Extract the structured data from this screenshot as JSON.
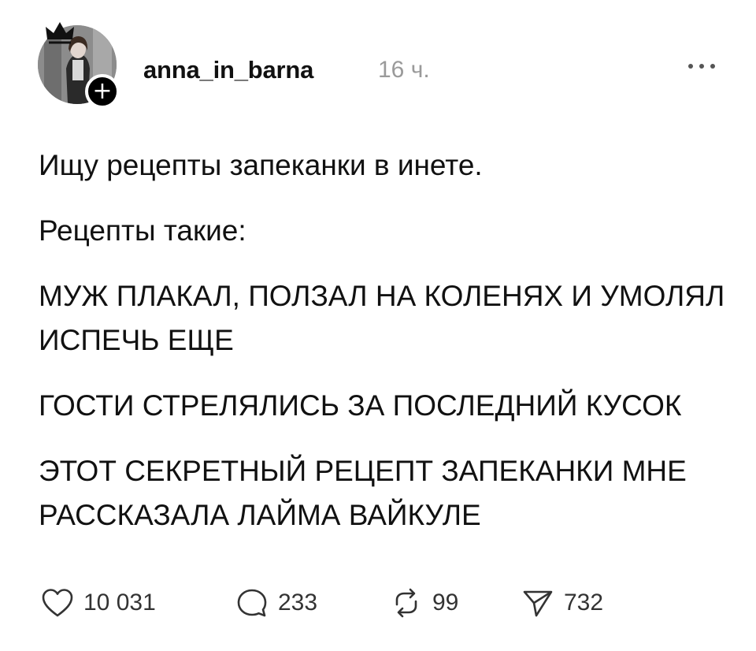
{
  "post": {
    "author": {
      "username": "anna_in_barna",
      "avatar_icon": "avatar-photo",
      "follow_label": "+"
    },
    "time_ago": "16 ч.",
    "more_icon": "ellipsis-icon",
    "paragraphs": [
      "Ищу рецепты запеканки в инете.",
      "Рецепты такие:",
      "МУЖ ПЛАКАЛ, ПОЛЗАЛ НА КОЛЕНЯХ И УМОЛЯЛ ИСПЕЧЬ ЕЩЕ",
      "ГОСТИ СТРЕЛЯЛИСЬ ЗА ПОСЛЕДНИЙ КУСОК",
      "ЭТОТ СЕКРЕТНЫЙ РЕЦЕПТ ЗАПЕКАНКИ МНЕ РАССКАЗАЛА ЛАЙМА ВАЙКУЛЕ"
    ],
    "actions": {
      "likes": "10 031",
      "replies": "233",
      "reposts": "99",
      "shares": "732"
    }
  }
}
